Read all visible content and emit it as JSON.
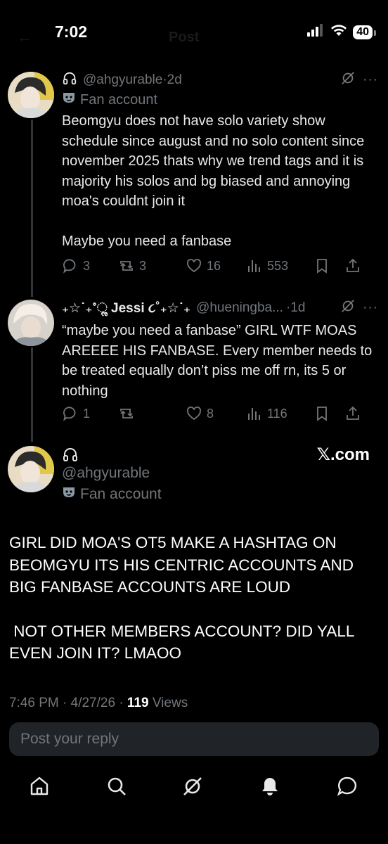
{
  "status_bar": {
    "time": "7:02",
    "battery": "40"
  },
  "header": {
    "ghost_title": "Post",
    "ghost_back": "←"
  },
  "tweet1": {
    "handle": "@ahgyurable",
    "separator": "·",
    "time": "2d",
    "more": "···",
    "badge": "Fan account",
    "text_p1": "Beomgyu does not have solo variety show schedule since august and no solo content since november 2025 thats why we trend tags and it is majority his solos and bg biased and annoying moa's couldnt join it",
    "text_p2": "Maybe you need a fanbase",
    "replies": "3",
    "reposts": "3",
    "likes": "16",
    "views": "553"
  },
  "tweet2": {
    "name": "₊☆˙₊˚ૢ Jessi ૮˚₊☆˙₊",
    "handle": "@hueningba...",
    "separator": "·",
    "time": "1d",
    "more": "···",
    "text": "“maybe you need a fanbase” GIRL WTF MOAS AREEEE HIS FANBASE. Every member needs to be treated equally don’t piss me off rn, its 5 or nothing",
    "replies": "1",
    "reposts": "",
    "likes": "8",
    "views": "116"
  },
  "main": {
    "handle": "@ahgyurable",
    "badge": "Fan account",
    "watermark": "𝕏.com",
    "text_p1": "GIRL DID MOA'S OT5 MAKE A HASHTAG ON BEOMGYU ITS HIS CENTRIC ACCOUNTS AND BIG FANBASE ACCOUNTS ARE LOUD",
    "text_p2": " NOT OTHER MEMBERS ACCOUNT? DID YALL EVEN JOIN IT? LMAOO",
    "timestamp": "7:46 PM · 4/27/26 · ",
    "views_count": "119",
    "views_label": " Views"
  },
  "reply_box": {
    "placeholder": "Post your reply"
  },
  "nav": {
    "items": [
      "home-icon",
      "search-icon",
      "grok-icon",
      "notifications-icon",
      "messages-icon"
    ]
  },
  "colors": {
    "background": "#000000",
    "text": "#e7e9ea",
    "muted": "#71767b",
    "reply_box": "#202327"
  }
}
